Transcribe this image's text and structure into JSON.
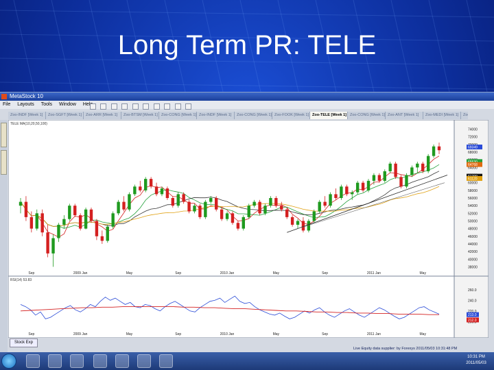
{
  "slide": {
    "title": "Long Term PR: TELE"
  },
  "app": {
    "title": "MetaStock 10",
    "menu": [
      "File",
      "Layouts",
      "Tools",
      "Window",
      "Help"
    ],
    "tabs": [
      "Zoo-INDF [Week 1]",
      "Zoo-SGFT [Week 1]",
      "Zoo-ARR [Week 1]",
      "Zoo-BTSM [Week 1]",
      "Zoo-CONG [Week 1]",
      "Zoo-INDF [Week 1]",
      "Zoo-CONG [Week 1]",
      "Zoo-FOOK [Week 1]",
      "Zoo-TELE [Week 1]",
      "Zoo-CONG [Week 1]",
      "Zoo-ANT [Week 1]",
      "Zoo-MEDI [Week 1]",
      "Zoo-INDF [Week 1]"
    ],
    "active_tab_index": 8,
    "side_tabs": [
      "Charts",
      "Fundamentals"
    ],
    "status_tab": "Stock Exp"
  },
  "chart_data": [
    {
      "type": "candlestick",
      "title": "TELE MA(10,20,50,100)",
      "x_tick_labels": [
        "Sep",
        "2009 Jan",
        "May",
        "Sep",
        "2010 Jan",
        "May",
        "Sep",
        "2011 Jan",
        "May"
      ],
      "y_tick_labels": [
        "74000",
        "72000",
        "70000",
        "68000",
        "66000",
        "64000",
        "62000",
        "60000",
        "58000",
        "56000",
        "54000",
        "52000",
        "50000",
        "48000",
        "46000",
        "44000",
        "42000",
        "40000",
        "38000"
      ],
      "ylim": [
        37000,
        75000
      ],
      "price_labels": [
        {
          "text": "69349",
          "value": 69349,
          "color": "#2a4bd7"
        },
        {
          "text": "65530",
          "value": 65530,
          "color": "#22a03a"
        },
        {
          "text": "64768",
          "value": 64768,
          "color": "#e06a10"
        },
        {
          "text": "61709",
          "value": 61709,
          "color": "#111111"
        },
        {
          "text": "61120",
          "value": 61120,
          "color": "#e0a010"
        }
      ],
      "ohlc": [
        [
          54000,
          56000,
          52000,
          55000
        ],
        [
          55000,
          56500,
          50000,
          51000
        ],
        [
          51000,
          52500,
          47000,
          48000
        ],
        [
          48000,
          53000,
          47500,
          52000
        ],
        [
          52000,
          53000,
          46000,
          47000
        ],
        [
          47000,
          49000,
          40500,
          41500
        ],
        [
          41500,
          46500,
          38000,
          45500
        ],
        [
          45500,
          49500,
          44500,
          49000
        ],
        [
          49000,
          51500,
          48000,
          50500
        ],
        [
          50500,
          54500,
          50000,
          54000
        ],
        [
          54000,
          54500,
          51000,
          51500
        ],
        [
          51500,
          52000,
          47500,
          48000
        ],
        [
          48000,
          53500,
          47800,
          53000
        ],
        [
          53000,
          53500,
          49500,
          50000
        ],
        [
          50000,
          50500,
          45000,
          46000
        ],
        [
          46000,
          47500,
          44000,
          44800
        ],
        [
          44800,
          49000,
          44300,
          48500
        ],
        [
          48500,
          52500,
          48000,
          52000
        ],
        [
          52000,
          55500,
          51500,
          55000
        ],
        [
          55000,
          56500,
          52500,
          53000
        ],
        [
          53000,
          57500,
          52500,
          57000
        ],
        [
          57000,
          59500,
          56500,
          59000
        ],
        [
          59000,
          60500,
          57500,
          58000
        ],
        [
          58000,
          61500,
          57500,
          61000
        ],
        [
          61000,
          61500,
          58500,
          59000
        ],
        [
          59000,
          60000,
          56500,
          57000
        ],
        [
          57000,
          59000,
          56500,
          58500
        ],
        [
          58500,
          59000,
          55500,
          56000
        ],
        [
          56000,
          56500,
          53500,
          54000
        ],
        [
          54000,
          57500,
          53500,
          57000
        ],
        [
          57000,
          57500,
          54500,
          55000
        ],
        [
          55000,
          55500,
          52000,
          52500
        ],
        [
          52500,
          54500,
          52000,
          54000
        ],
        [
          54000,
          54500,
          50500,
          51000
        ],
        [
          51000,
          55500,
          50500,
          55000
        ],
        [
          55000,
          56500,
          54500,
          56000
        ],
        [
          56000,
          56500,
          52500,
          53000
        ],
        [
          53000,
          53500,
          50000,
          50500
        ],
        [
          50500,
          52500,
          50000,
          52000
        ],
        [
          52000,
          52500,
          49000,
          49500
        ],
        [
          49500,
          50000,
          47500,
          48000
        ],
        [
          48000,
          51500,
          47500,
          51000
        ],
        [
          51000,
          54500,
          50500,
          54000
        ],
        [
          54000,
          55500,
          53500,
          55000
        ],
        [
          55000,
          55500,
          51500,
          52000
        ],
        [
          52000,
          54500,
          51500,
          54000
        ],
        [
          54000,
          56500,
          53500,
          56000
        ],
        [
          56000,
          56500,
          53500,
          54000
        ],
        [
          54000,
          55000,
          52500,
          53000
        ],
        [
          53000,
          53500,
          50500,
          51000
        ],
        [
          51000,
          51500,
          48500,
          49000
        ],
        [
          49000,
          50500,
          48000,
          50000
        ],
        [
          50000,
          51000,
          47000,
          47500
        ],
        [
          47500,
          50500,
          47000,
          50000
        ],
        [
          50000,
          53000,
          49500,
          52500
        ],
        [
          52500,
          55500,
          52000,
          55000
        ],
        [
          55000,
          56500,
          53500,
          54000
        ],
        [
          54000,
          57500,
          53500,
          57000
        ],
        [
          57000,
          58500,
          55500,
          56000
        ],
        [
          56000,
          59500,
          55500,
          59000
        ],
        [
          59000,
          59500,
          56500,
          57000
        ],
        [
          57000,
          58000,
          55500,
          57500
        ],
        [
          57500,
          60500,
          57000,
          60000
        ],
        [
          60000,
          60500,
          57500,
          58000
        ],
        [
          58000,
          61000,
          57500,
          60500
        ],
        [
          60500,
          62500,
          59500,
          62000
        ],
        [
          62000,
          62500,
          60000,
          60500
        ],
        [
          60500,
          63500,
          60000,
          63000
        ],
        [
          63000,
          65500,
          62500,
          65000
        ],
        [
          65000,
          65500,
          61000,
          61500
        ],
        [
          61500,
          62000,
          58500,
          59000
        ],
        [
          59000,
          62500,
          58500,
          62000
        ],
        [
          62000,
          64500,
          61500,
          64000
        ],
        [
          64000,
          65500,
          62500,
          65000
        ],
        [
          65000,
          65500,
          62500,
          63000
        ],
        [
          63000,
          67500,
          62500,
          67000
        ],
        [
          67000,
          70000,
          66500,
          69500
        ],
        [
          69500,
          70500,
          67500,
          68500
        ]
      ]
    },
    {
      "type": "line",
      "title": "RSI(14) 53.83",
      "x_tick_labels": [
        "Sep",
        "2009 Jan",
        "May",
        "Sep",
        "2010 Jan",
        "May",
        "Sep",
        "2011 Jan",
        "May"
      ],
      "y_tick_labels": [
        "260.0",
        "240.0",
        "220.0",
        "200.0"
      ],
      "ylim": [
        190,
        270
      ],
      "price_labels": [
        {
          "text": "213.0",
          "value": 213.0,
          "color": "#2a4bd7"
        },
        {
          "text": "212.0",
          "value": 212.0,
          "color": "#d42020"
        }
      ],
      "series": [
        {
          "values": [
            232,
            228,
            222,
            212,
            218,
            205,
            208,
            214,
            220,
            226,
            230,
            222,
            218,
            224,
            232,
            228,
            238,
            246,
            240,
            244,
            238,
            232,
            236,
            228,
            226,
            232,
            230,
            224,
            220,
            228,
            234,
            238,
            232,
            226,
            220,
            218,
            226,
            232,
            238,
            240,
            244,
            236,
            242,
            248,
            238,
            234,
            236,
            228,
            222,
            218,
            214,
            212,
            216,
            210,
            205,
            208,
            214,
            220,
            216,
            222,
            226,
            218,
            212,
            208,
            214,
            220,
            224,
            218,
            212,
            208,
            214,
            220,
            226,
            222,
            216,
            210,
            205,
            208,
            214,
            220,
            226,
            228,
            222,
            218,
            214
          ]
        },
        {
          "values": [
            220,
            221,
            222,
            223,
            224,
            225,
            226,
            226,
            227,
            227,
            228,
            228,
            228,
            228,
            228,
            228,
            227,
            227,
            226,
            226,
            225,
            224,
            224,
            223,
            222,
            221,
            220,
            220,
            219,
            218,
            218,
            217,
            217,
            216,
            216,
            215,
            215,
            214,
            214,
            214,
            213,
            213
          ]
        }
      ]
    }
  ],
  "data_supply": "Live Equity data supplier: by Forexys      2011/05/03 10:31:48 PM",
  "taskbar": {
    "time": "10:31 PM",
    "date": "2011/05/03"
  }
}
